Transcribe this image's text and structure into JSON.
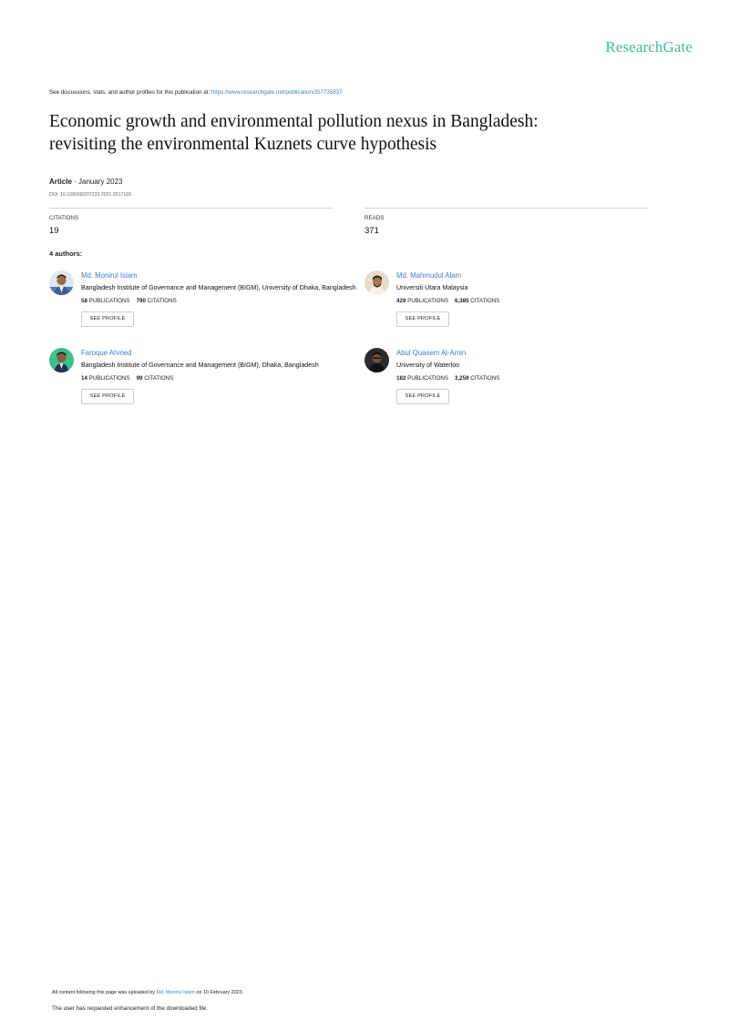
{
  "brand": {
    "logo_text": "ResearchGate",
    "color": "#40ba9b"
  },
  "header": {
    "discussion_prefix": "See discussions, stats, and author profiles for this publication at: ",
    "publication_url": "https://www.researchgate.net/publication/357735837"
  },
  "paper": {
    "title_line1": "Economic growth and environmental pollution nexus in Bangladesh:",
    "title_line2": "revisiting the environmental Kuznets curve hypothesis",
    "type": "Article",
    "date": "· January 2023",
    "doi": "DOI: 10.1080/00207233.2021.2017169"
  },
  "stats": {
    "citations_label": "CITATIONS",
    "citations_value": "19",
    "reads_label": "READS",
    "reads_value": "371"
  },
  "authors_heading": "4 authors:",
  "authors": [
    {
      "name": "Md. Monirul Islam",
      "institution": "Bangladesh Institute of Governance and Management (BIGM), University of Dhaka, Bangladesh",
      "publications": "58",
      "publications_label": "PUBLICATIONS",
      "citations": "790",
      "citations_label": "CITATIONS",
      "button": "SEE PROFILE"
    },
    {
      "name": "Md. Mahmudul Alam",
      "institution": "Universiti Utara Malaysia",
      "publications": "429",
      "publications_label": "PUBLICATIONS",
      "citations": "6,385",
      "citations_label": "CITATIONS",
      "button": "SEE PROFILE"
    },
    {
      "name": "Faroque Ahmed",
      "institution": "Bangladesh Institute of Governance and Management (BIGM), Dhaka, Bangladesh",
      "publications": "14",
      "publications_label": "PUBLICATIONS",
      "citations": "99",
      "citations_label": "CITATIONS",
      "button": "SEE PROFILE"
    },
    {
      "name": "Abul Quasem Al-Amin",
      "institution": "University of Waterloo",
      "publications": "182",
      "publications_label": "PUBLICATIONS",
      "citations": "3,259",
      "citations_label": "CITATIONS",
      "button": "SEE PROFILE"
    }
  ],
  "footer": {
    "upload_prefix": "All content following this page was uploaded by ",
    "uploader": "Md. Monirul Islam",
    "upload_suffix": " on 10 February 2023.",
    "enhancement_note": "The user has requested enhancement of the downloaded file."
  },
  "colors": {
    "link": "#3f7fc4",
    "rule": "#cfd6da"
  }
}
